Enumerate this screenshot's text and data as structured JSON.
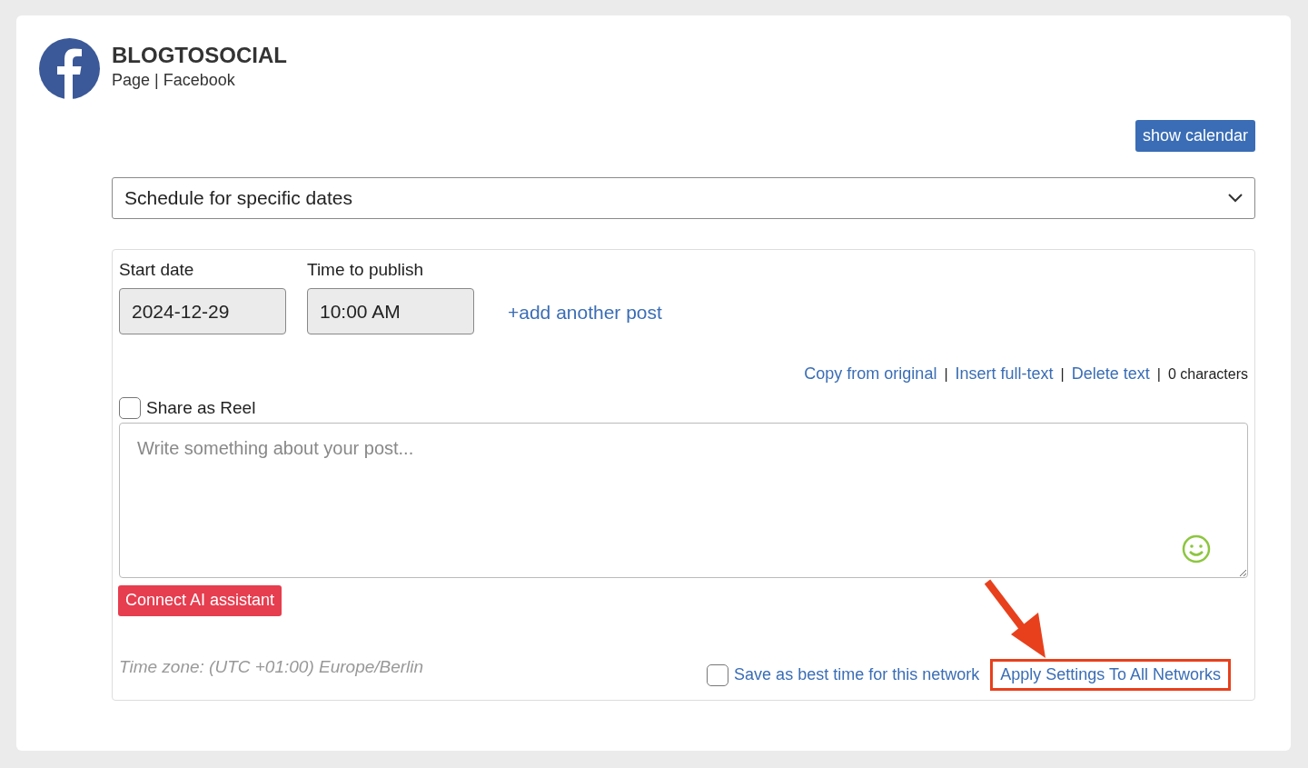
{
  "account": {
    "name": "BLOGTOSOCIAL",
    "subtitle": "Page | Facebook"
  },
  "show_calendar_button": "show calendar",
  "schedule_select": {
    "value": "Schedule for specific dates"
  },
  "schedule": {
    "start_date": {
      "label": "Start date",
      "value": "2024-12-29"
    },
    "time": {
      "label": "Time to publish",
      "value": "10:00 AM"
    },
    "add_post_link": "+add another post"
  },
  "text_actions": [
    {
      "kind": "link",
      "text": "Copy from original"
    },
    {
      "kind": "separator",
      "text": "|"
    },
    {
      "kind": "link",
      "text": "Insert full-text"
    },
    {
      "kind": "separator",
      "text": "|"
    },
    {
      "kind": "link",
      "text": "Delete text"
    },
    {
      "kind": "separator",
      "text": "|"
    },
    {
      "kind": "count",
      "text": "0 characters"
    }
  ],
  "share_as_reel": {
    "label": "Share as Reel",
    "checked": false
  },
  "post_text": {
    "placeholder": "Write something about your post..."
  },
  "ai_button": "Connect AI assistant",
  "timezone": "Time zone: (UTC +01:00) Europe/Berlin",
  "best_time": {
    "label": "Save as best time for this network",
    "checked": false
  },
  "apply_link": {
    "text": "Apply Settings To All Networks",
    "highlighted": true
  }
}
